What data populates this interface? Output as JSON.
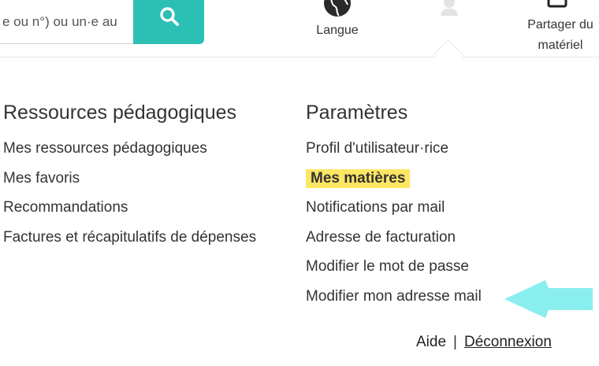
{
  "search": {
    "placeholder": "e ou n°) ou un·e au"
  },
  "header": {
    "language_label": "Langue",
    "share_label_line1": "Partager du",
    "share_label_line2": "matériel"
  },
  "menu": {
    "left": {
      "title": "Ressources pédagogiques",
      "items": [
        "Mes ressources pédagogiques",
        "Mes favoris",
        "Recommandations",
        "Factures et récapitulatifs de dépenses"
      ]
    },
    "right": {
      "title": "Paramètres",
      "items": [
        "Profil d'utilisateur·rice",
        "Mes matières",
        "Notifications par mail",
        "Adresse de facturation",
        "Modifier le mot de passe",
        "Modifier mon adresse mail"
      ],
      "active_item": "Mes matières"
    }
  },
  "footer": {
    "help_label": "Aide",
    "separator": "|",
    "logout_label": "Déconnexion"
  },
  "colors": {
    "accent": "#2cbfb3",
    "highlight": "#fde663",
    "annotation_arrow": "#8beeee"
  },
  "icons": [
    "search-icon",
    "globe-icon",
    "avatar-icon",
    "share-icon",
    "pointer-arrow-icon"
  ]
}
